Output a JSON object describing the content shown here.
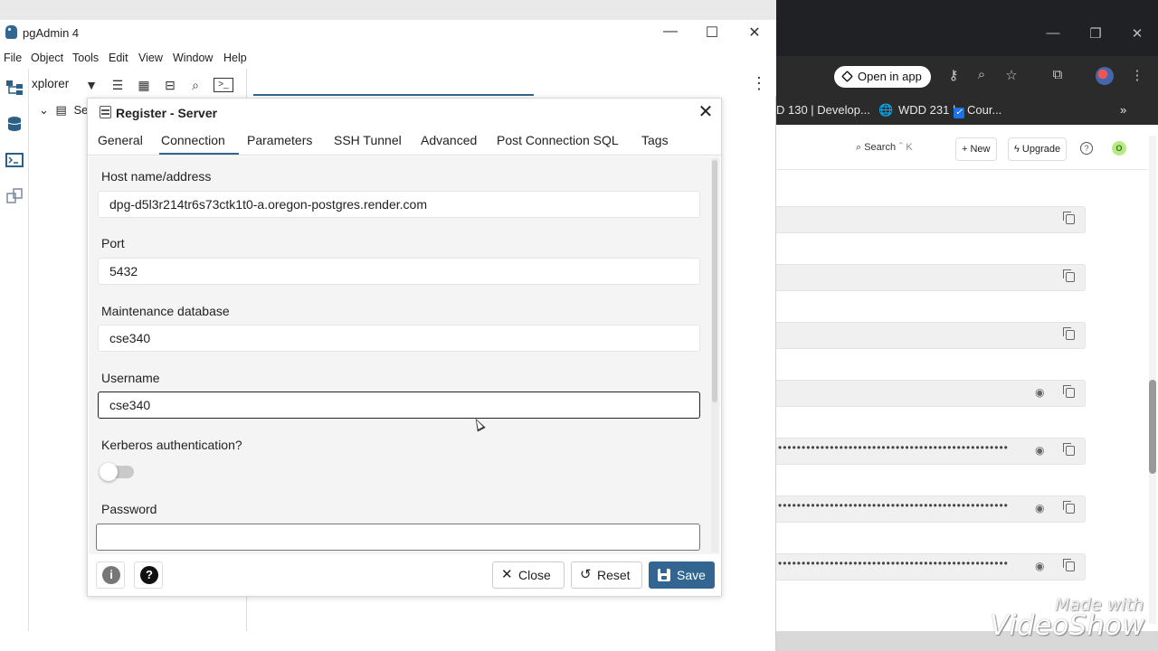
{
  "pgadmin": {
    "title": "pgAdmin 4",
    "window_controls": {
      "minimize": "—",
      "maximize": "☐",
      "close": "✕"
    },
    "menu": [
      "File",
      "Object",
      "Tools",
      "Edit",
      "View",
      "Window",
      "Help"
    ],
    "object_explorer": {
      "tab_label": "xplorer",
      "tree_item": "Se"
    },
    "kebab": "⋮"
  },
  "dialog": {
    "title": "Register - Server",
    "close_glyph": "✕",
    "tabs": [
      "General",
      "Connection",
      "Parameters",
      "SSH Tunnel",
      "Advanced",
      "Post Connection SQL",
      "Tags"
    ],
    "active_tab": "Connection",
    "fields": {
      "host": {
        "label": "Host name/address",
        "value": "dpg-d5l3r214tr6s73ctk1t0-a.oregon-postgres.render.com"
      },
      "port": {
        "label": "Port",
        "value": "5432"
      },
      "maintenance_db": {
        "label": "Maintenance database",
        "value": "cse340"
      },
      "username": {
        "label": "Username",
        "value": "cse340"
      },
      "kerberos": {
        "label": "Kerberos authentication?",
        "enabled": false
      },
      "password": {
        "label": "Password",
        "value": ""
      }
    },
    "footer": {
      "info_glyph": "i",
      "help_glyph": "?",
      "close_label": "Close",
      "reset_label": "Reset",
      "save_label": "Save"
    }
  },
  "browser": {
    "open_in_app": "Open in app",
    "bookmarks": [
      "D 130 | Develop...",
      "WDD 231 |",
      "Cour..."
    ],
    "search_label": "Search",
    "search_shortcut": "⌃ K",
    "new_label": "+ New",
    "upgrade_label": "Upgrade",
    "help_glyph": "?",
    "avatar_letter": "O",
    "env_rows": [
      {
        "secret": false,
        "masked": ""
      },
      {
        "secret": false,
        "masked": ""
      },
      {
        "secret": false,
        "masked": ""
      },
      {
        "secret": true,
        "masked": ""
      },
      {
        "secret": true,
        "masked": "•••••••••••••••••••••••••••••••••••••••••••••••••"
      },
      {
        "secret": true,
        "masked": "•••••••••••••••••••••••••••••••••••••••••••••••••"
      },
      {
        "secret": true,
        "masked": "•••••••••••••••••••••••••••••••••••••••••••••••••"
      }
    ]
  },
  "watermark": {
    "line1": "Made with",
    "line2": "VideoShow"
  },
  "colors": {
    "pgadmin_accent": "#326690",
    "save_button": "#326690"
  }
}
